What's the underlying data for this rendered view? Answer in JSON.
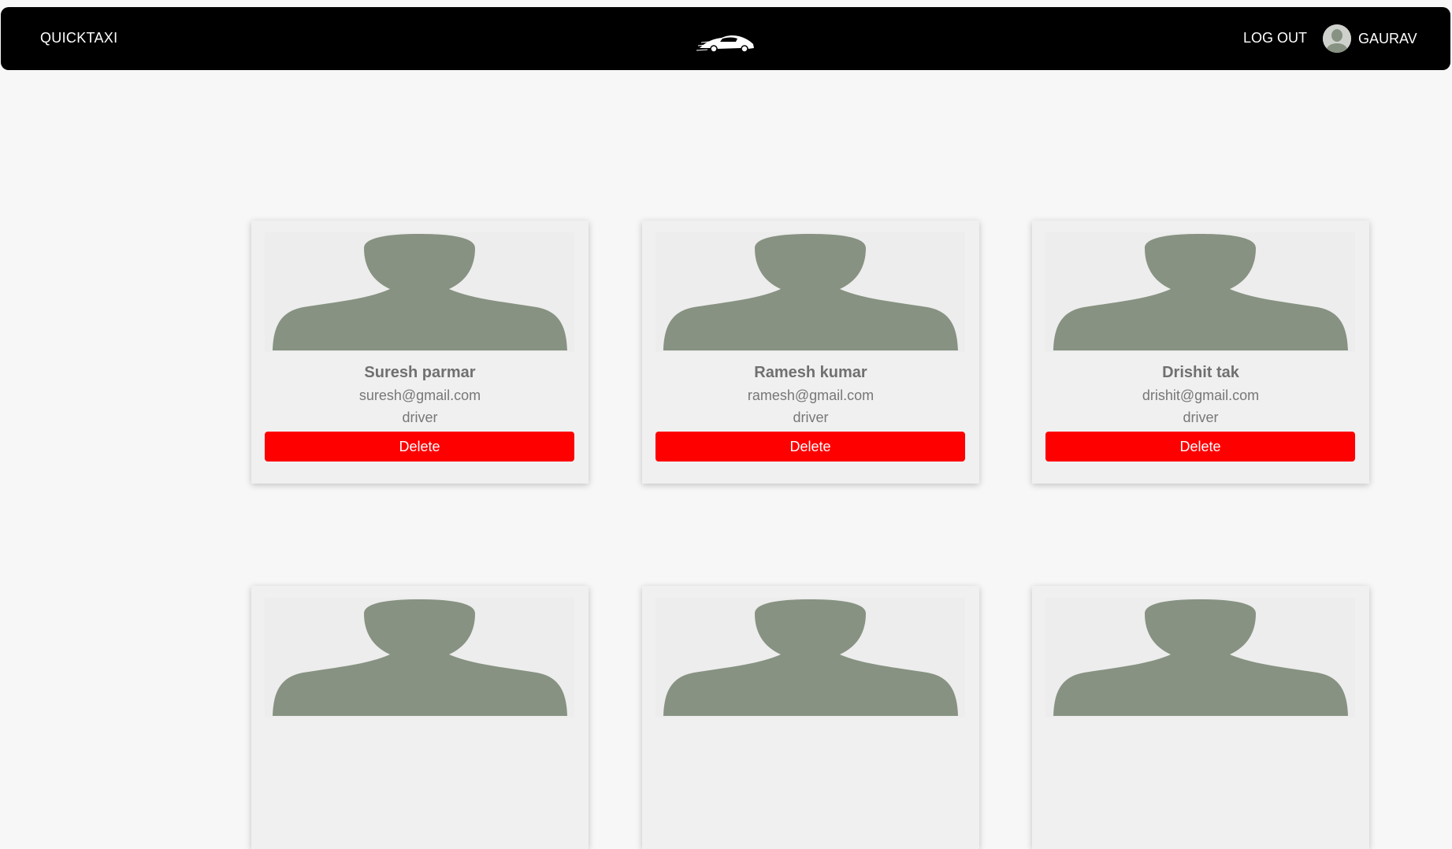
{
  "header": {
    "brand": "QUICKTAXI",
    "logo_icon": "car-logo-icon",
    "logout_label": "LOG OUT",
    "username": "GAURAV",
    "avatar_icon": "user-avatar-icon"
  },
  "colors": {
    "navbar": "#000000",
    "page_background": "#f7f7f7",
    "card_background": "#f0f0f0",
    "delete_button": "#ff0000",
    "silhouette": "#879282"
  },
  "users": [
    {
      "name": "Suresh parmar",
      "email": "suresh@gmail.com",
      "role": "driver",
      "delete_label": "Delete"
    },
    {
      "name": "Ramesh kumar",
      "email": "ramesh@gmail.com",
      "role": "driver",
      "delete_label": "Delete"
    },
    {
      "name": "Drishit tak",
      "email": "drishit@gmail.com",
      "role": "driver",
      "delete_label": "Delete"
    },
    {
      "name": "",
      "email": "",
      "role": "",
      "delete_label": ""
    },
    {
      "name": "",
      "email": "",
      "role": "",
      "delete_label": ""
    },
    {
      "name": "",
      "email": "",
      "role": "",
      "delete_label": ""
    }
  ]
}
